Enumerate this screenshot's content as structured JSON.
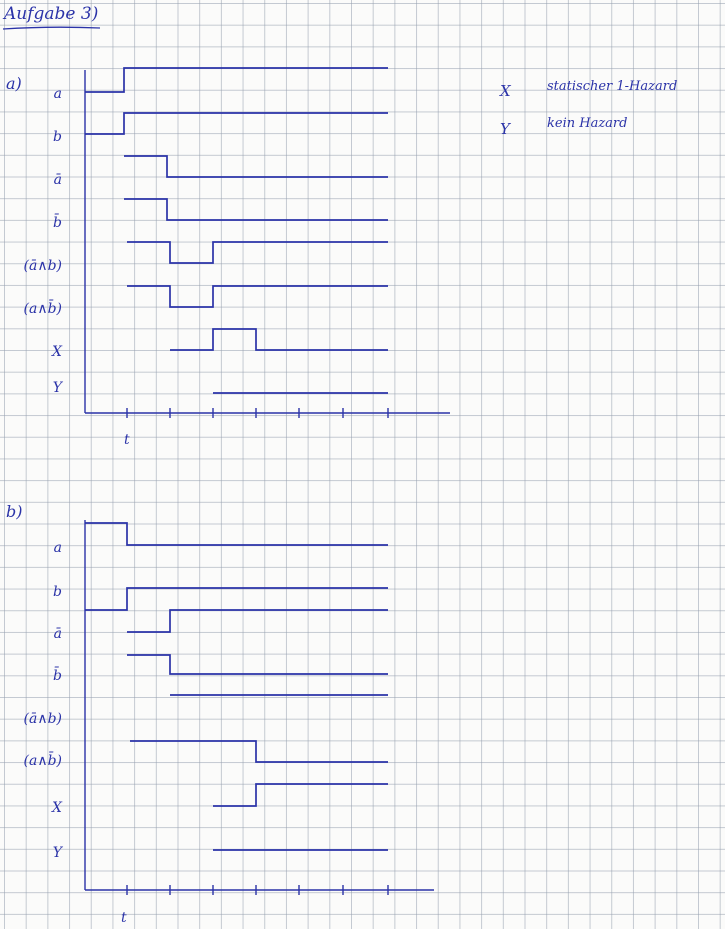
{
  "ink_color": "#2b33a8",
  "title": "Aufgabe 3)",
  "legend": [
    {
      "name": "X",
      "text": "statischer 1-Hazard"
    },
    {
      "name": "Y",
      "text": "kein Hazard"
    }
  ],
  "parts": [
    {
      "id": "a",
      "label": "a)",
      "axis_label": "t",
      "signals": [
        {
          "label": "a",
          "levels": [
            0,
            1,
            1,
            1,
            1,
            1,
            1
          ]
        },
        {
          "label": "b",
          "levels": [
            0,
            1,
            1,
            1,
            1,
            1,
            1
          ]
        },
        {
          "label": "ā",
          "levels": [
            1,
            0,
            0,
            0,
            0,
            0
          ]
        },
        {
          "label": "b̄",
          "levels": [
            1,
            0,
            0,
            0,
            0,
            0
          ]
        },
        {
          "label": "(ā∧b)",
          "levels": [
            1,
            0,
            1,
            1,
            1,
            1
          ]
        },
        {
          "label": "(a∧b̄)",
          "levels": [
            1,
            0,
            1,
            1,
            1,
            1
          ]
        },
        {
          "label": "X",
          "levels": [
            0,
            1,
            0,
            0,
            0
          ]
        },
        {
          "label": "Y",
          "levels": [
            0,
            0,
            0,
            0
          ]
        }
      ]
    },
    {
      "id": "b",
      "label": "b)",
      "axis_label": "t",
      "signals": [
        {
          "label": "a",
          "levels": [
            1,
            0,
            0,
            0,
            0,
            0,
            0
          ]
        },
        {
          "label": "b",
          "levels": [
            0,
            1,
            1,
            1,
            1,
            1,
            1
          ]
        },
        {
          "label": "ā",
          "levels": [
            0,
            1,
            1,
            1,
            1,
            1
          ]
        },
        {
          "label": "b̄",
          "levels": [
            1,
            0,
            0,
            0,
            0,
            0
          ]
        },
        {
          "label": "(ā∧b)",
          "levels": [
            1,
            1,
            1,
            1,
            1
          ]
        },
        {
          "label": "(a∧b̄)",
          "levels": [
            1,
            1,
            0,
            0,
            0,
            0
          ]
        },
        {
          "label": "X",
          "levels": [
            0,
            1,
            1,
            1
          ]
        },
        {
          "label": "Y",
          "levels": [
            0,
            0,
            0,
            0
          ]
        }
      ]
    }
  ]
}
